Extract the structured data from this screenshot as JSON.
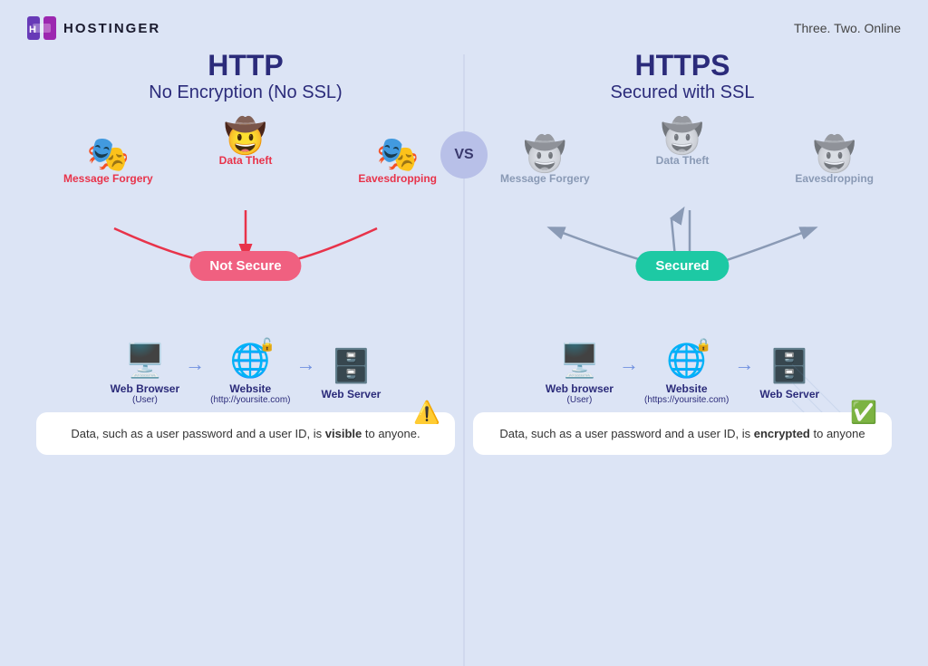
{
  "header": {
    "logo": "HOSTINGER",
    "tagline": "Three. Two. Online"
  },
  "vs": {
    "label": "VS"
  },
  "http": {
    "title": "HTTP",
    "subtitle": "No Encryption (No SSL)",
    "status": "Not Secure",
    "threats": [
      {
        "label": "Message Forgery"
      },
      {
        "label": "Data Theft"
      },
      {
        "label": "Eavesdropping"
      }
    ],
    "devices": [
      {
        "name": "Web Browser",
        "sub": "(User)"
      },
      {
        "name": "Website",
        "sub": "(http://yoursite.com)"
      },
      {
        "name": "Web Server",
        "sub": ""
      }
    ],
    "info": {
      "part1": "Data, such as a user password and a user ID, is ",
      "bold": "visible",
      "part2": " to anyone."
    }
  },
  "https": {
    "title": "HTTPS",
    "subtitle": "Secured with SSL",
    "status": "Secured",
    "threats": [
      {
        "label": "Message Forgery"
      },
      {
        "label": "Data Theft"
      },
      {
        "label": "Eavesdropping"
      }
    ],
    "devices": [
      {
        "name": "Web browser",
        "sub": "(User)"
      },
      {
        "name": "Website",
        "sub": "(https://yoursite.com)"
      },
      {
        "name": "Web Server",
        "sub": ""
      }
    ],
    "info": {
      "part1": "Data, such as a user password and a user ID, is ",
      "bold": "encrypted",
      "part2": " to anyone"
    }
  }
}
